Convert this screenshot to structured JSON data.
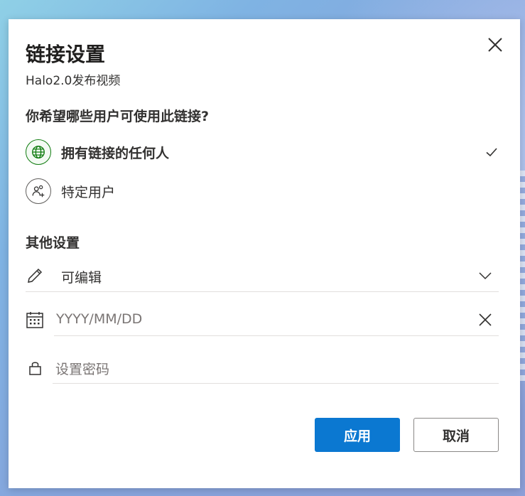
{
  "dialog": {
    "title": "链接设置",
    "subtitle": "Halo2.0发布视频",
    "question": "你希望哪些用户可使用此链接?",
    "options": [
      {
        "label": "拥有链接的任何人",
        "icon": "globe-icon",
        "selected": true
      },
      {
        "label": "特定用户",
        "icon": "people-icon",
        "selected": false
      }
    ],
    "other_settings_title": "其他设置",
    "permission": {
      "value": "可编辑",
      "icon": "pencil-icon"
    },
    "expiry": {
      "placeholder": "YYYY/MM/DD",
      "icon": "calendar-icon"
    },
    "password": {
      "placeholder": "设置密码",
      "icon": "lock-icon"
    },
    "buttons": {
      "apply": "应用",
      "cancel": "取消"
    }
  },
  "colors": {
    "accent": "#0b78d1",
    "globe_green": "#107c10",
    "text": "#323130",
    "divider": "#e1dfdd"
  }
}
